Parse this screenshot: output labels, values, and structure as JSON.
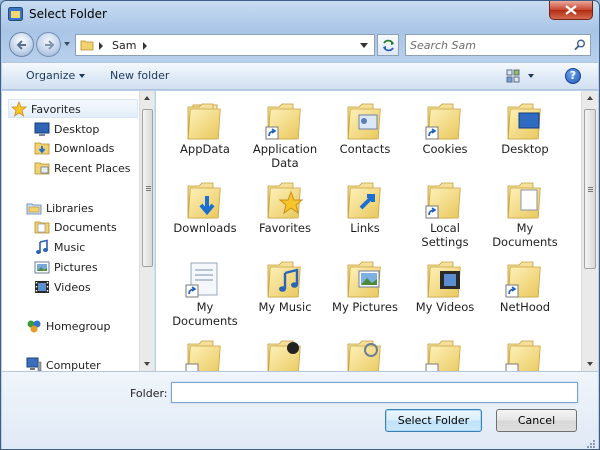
{
  "window": {
    "title": "Select Folder"
  },
  "address": {
    "path": [
      "Sam"
    ],
    "search_placeholder": "Search Sam"
  },
  "toolbar": {
    "organize_label": "Organize",
    "new_folder_label": "New folder",
    "help_label": "?"
  },
  "nav_pane": {
    "items": [
      {
        "label": "Favorites",
        "icon": "star-icon"
      },
      {
        "label": "Desktop",
        "icon": "desktop-icon"
      },
      {
        "label": "Downloads",
        "icon": "downloads-icon"
      },
      {
        "label": "Recent Places",
        "icon": "recent-places-icon"
      },
      {
        "label": "Libraries",
        "icon": "libraries-icon"
      },
      {
        "label": "Documents",
        "icon": "documents-icon"
      },
      {
        "label": "Music",
        "icon": "music-icon"
      },
      {
        "label": "Pictures",
        "icon": "pictures-icon"
      },
      {
        "label": "Videos",
        "icon": "videos-icon"
      },
      {
        "label": "Homegroup",
        "icon": "homegroup-icon"
      },
      {
        "label": "Computer",
        "icon": "computer-icon"
      }
    ]
  },
  "content": {
    "folders": [
      {
        "label": "AppData",
        "shortcut": false
      },
      {
        "label": "Application Data",
        "shortcut": true
      },
      {
        "label": "Contacts",
        "shortcut": false
      },
      {
        "label": "Cookies",
        "shortcut": true
      },
      {
        "label": "Desktop",
        "shortcut": false
      },
      {
        "label": "Downloads",
        "shortcut": false
      },
      {
        "label": "Favorites",
        "shortcut": false
      },
      {
        "label": "Links",
        "shortcut": false
      },
      {
        "label": "Local Settings",
        "shortcut": true
      },
      {
        "label": "My Documents",
        "shortcut": false
      },
      {
        "label": "My Documents",
        "shortcut": true
      },
      {
        "label": "My Music",
        "shortcut": false
      },
      {
        "label": "My Pictures",
        "shortcut": false
      },
      {
        "label": "My Videos",
        "shortcut": false
      },
      {
        "label": "NetHood",
        "shortcut": true
      }
    ]
  },
  "bottom": {
    "folder_label": "Folder:",
    "folder_value": "",
    "select_button": "Select Folder",
    "cancel_button": "Cancel"
  },
  "colors": {
    "folder": "#f2d77c",
    "folder_dark": "#d9b54b",
    "accent": "#1e395b"
  }
}
